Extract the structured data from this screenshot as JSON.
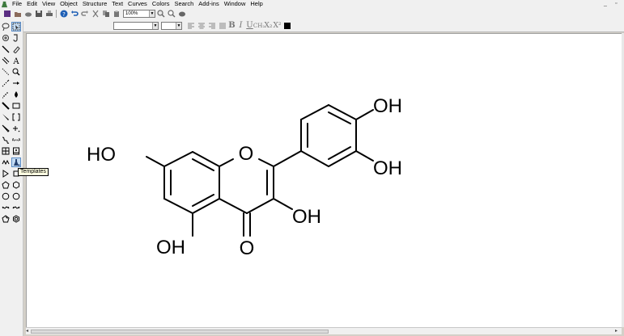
{
  "menu": {
    "items": [
      "File",
      "Edit",
      "View",
      "Object",
      "Structure",
      "Text",
      "Curves",
      "Colors",
      "Search",
      "Add-ins",
      "Window",
      "Help"
    ],
    "minimize": "_",
    "restore": "▫"
  },
  "toolbar": {
    "zoom_value": "100%"
  },
  "palette": {
    "tooltip": "Templates"
  },
  "molecule": {
    "labels": {
      "ring_oxygen": "O",
      "carbonyl_oxygen": "O",
      "oh_top_right": "OH",
      "oh_right": "OH",
      "oh_three": "OH",
      "oh_seven": "HO",
      "oh_five": "OH"
    }
  },
  "colors": {
    "active_tool_bg": "#c4dcf4",
    "tooltip_bg": "#ffffe1",
    "canvas_bg": "#ffffff"
  }
}
